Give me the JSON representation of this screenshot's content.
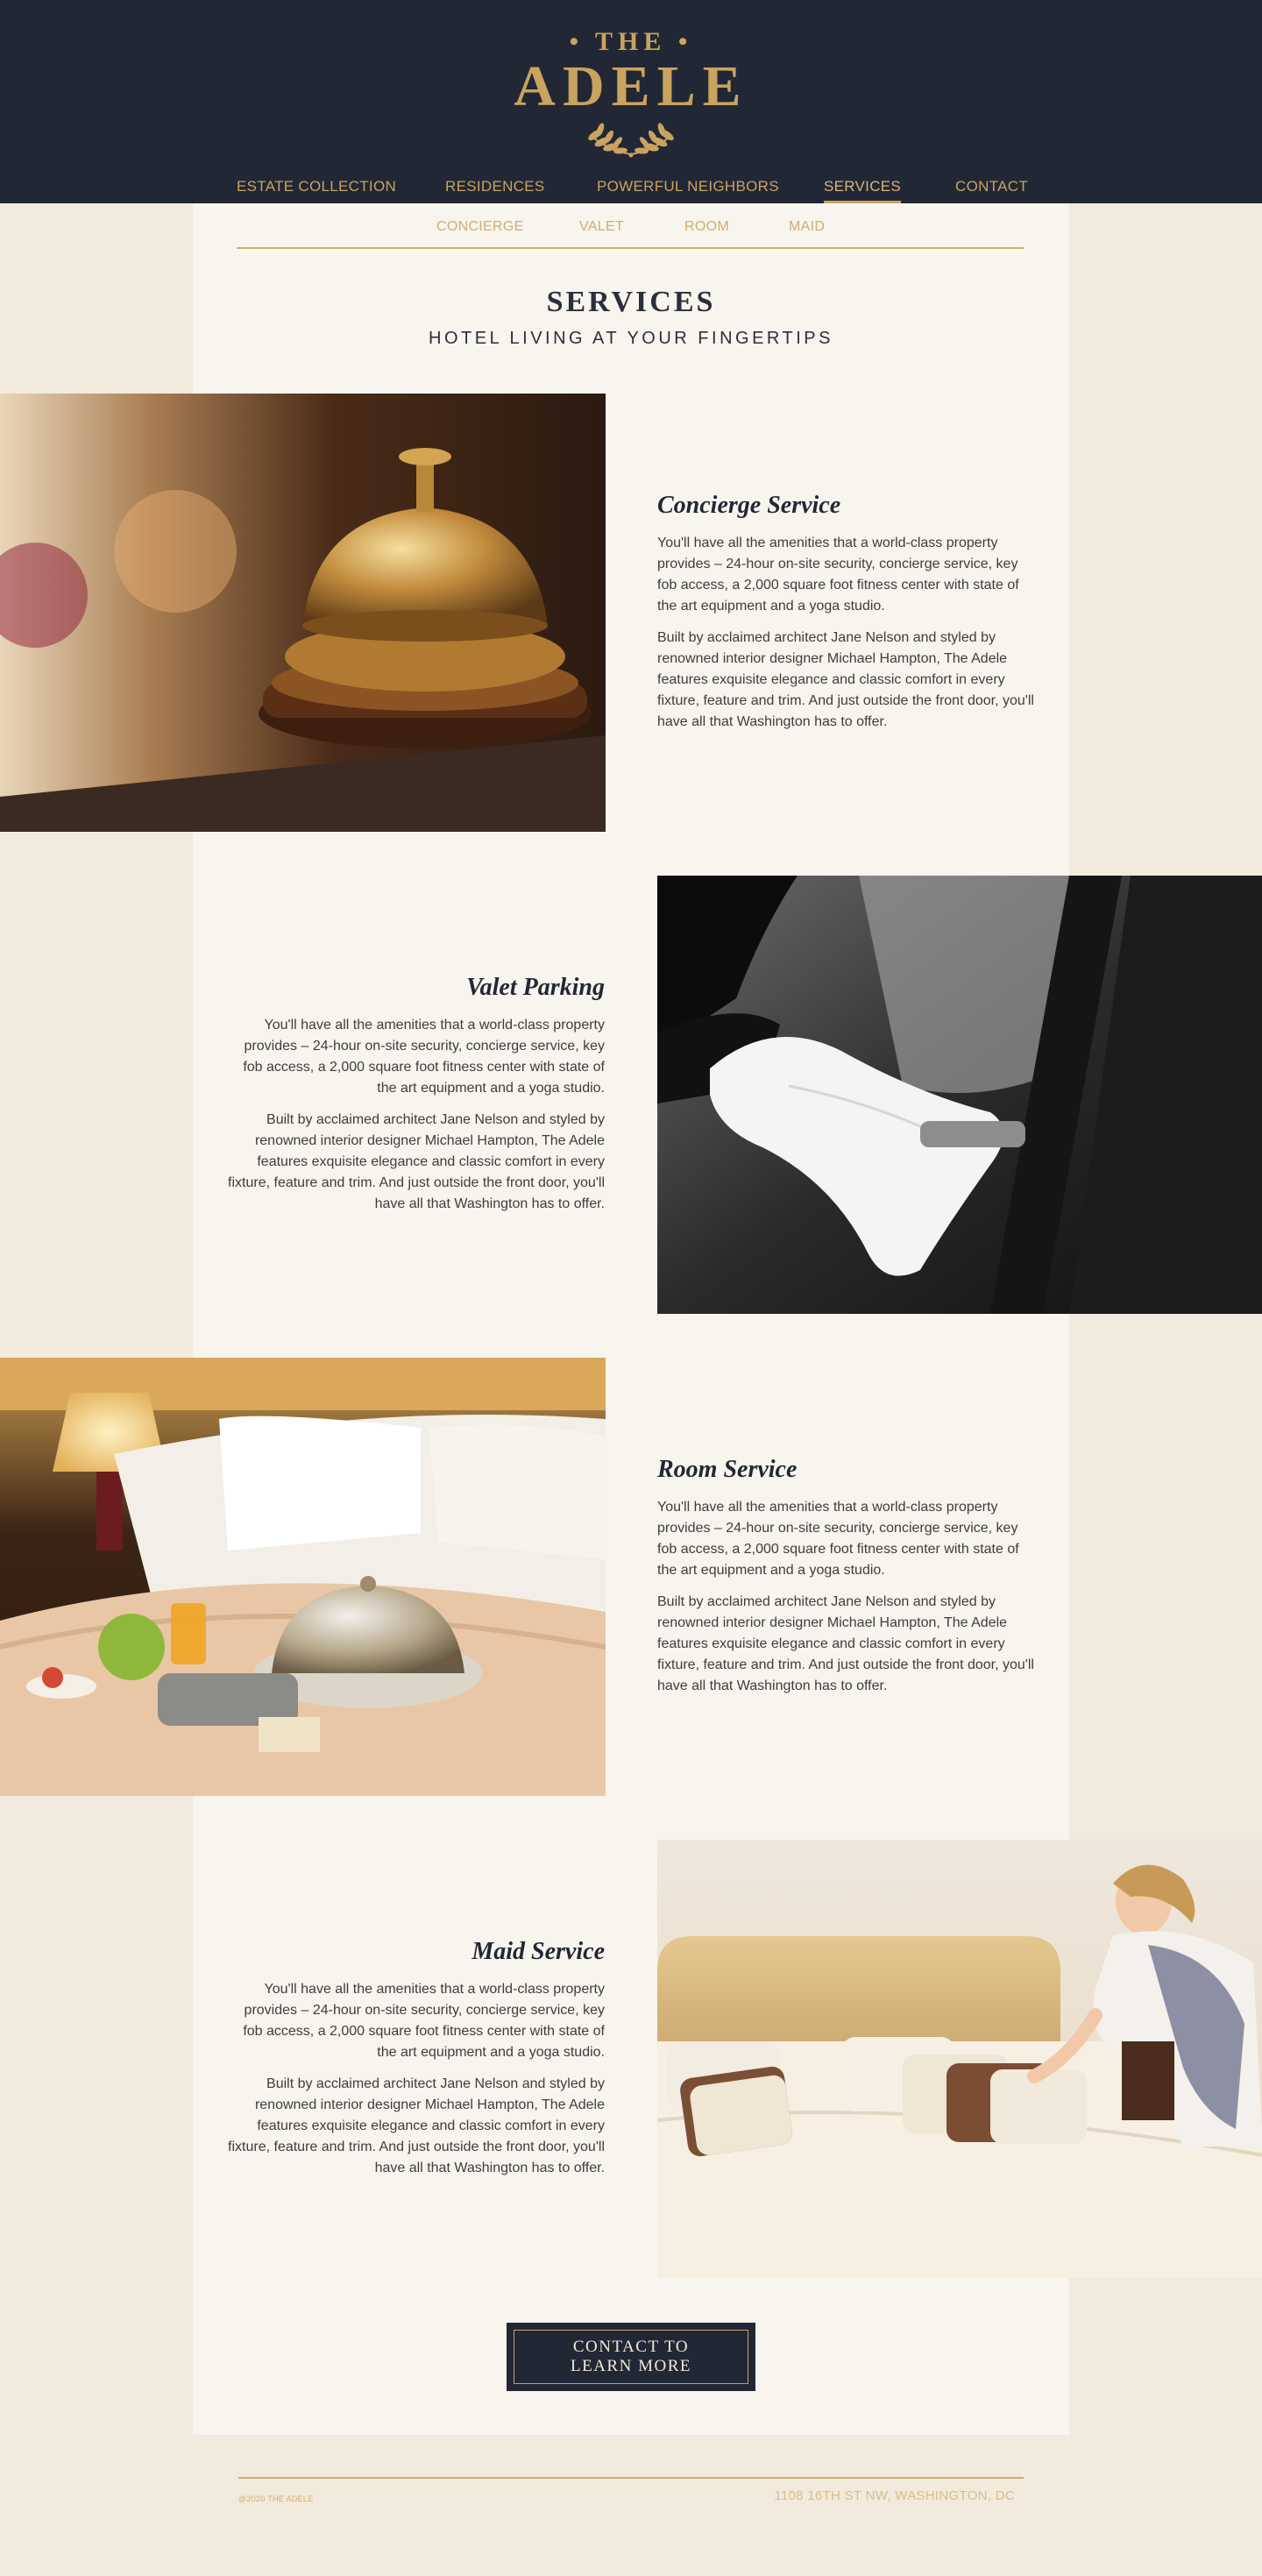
{
  "brand": {
    "the": "• THE •",
    "name": "ADELE",
    "laurel_icon": "laurel-wreath-icon"
  },
  "nav": {
    "items": [
      {
        "label": "ESTATE COLLECTION",
        "active": false
      },
      {
        "label": "RESIDENCES",
        "active": false
      },
      {
        "label": "POWERFUL NEIGHBORS",
        "active": false
      },
      {
        "label": "SERVICES",
        "active": true
      },
      {
        "label": "CONTACT",
        "active": false
      }
    ]
  },
  "subnav": {
    "items": [
      "CONCIERGE",
      "VALET",
      "ROOM",
      "MAID"
    ]
  },
  "page": {
    "title": "SERVICES",
    "subtitle": "HOTEL LIVING AT YOUR FINGERTIPS"
  },
  "services": [
    {
      "title": "Concierge Service",
      "p1": "You'll have all the amenities that a world-class property provides – 24-hour on-site security, concierge service, key fob access, a 2,000 square foot fitness center with state of the art equipment and a yoga studio.",
      "p2": "Built by acclaimed architect Jane Nelson and styled by renowned interior designer Michael Hampton, The Adele features exquisite elegance and classic comfort in every fixture, feature and trim. And just outside the front door, you'll have all that Washington has to offer.",
      "image": "concierge-bell-photo"
    },
    {
      "title": "Valet Parking",
      "p1": "You'll have all the amenities that a world-class property provides – 24-hour on-site security, concierge service, key fob access, a 2,000 square foot fitness center with state of the art equipment and a yoga studio.",
      "p2": "Built by acclaimed architect Jane Nelson and styled by renowned interior designer Michael Hampton, The Adele features exquisite elegance and classic comfort in every fixture, feature and trim. And just outside the front door, you'll have all that Washington has to offer.",
      "image": "valet-gloved-hand-photo"
    },
    {
      "title": "Room Service",
      "p1": "You'll have all the amenities that a world-class property provides – 24-hour on-site security, concierge service, key fob access, a 2,000 square foot fitness center with state of the art equipment and a yoga studio.",
      "p2": "Built by acclaimed architect Jane Nelson and styled by renowned interior designer Michael Hampton, The Adele features exquisite elegance and classic comfort in every fixture, feature and trim. And just outside the front door, you'll have all that Washington has to offer.",
      "image": "room-service-tray-photo"
    },
    {
      "title": "Maid Service",
      "p1": "You'll have all the amenities that a world-class property provides – 24-hour on-site security, concierge service, key fob access, a 2,000 square foot fitness center with state of the art equipment and a yoga studio.",
      "p2": "Built by acclaimed architect Jane Nelson and styled by renowned interior designer Michael Hampton, The Adele features exquisite elegance and classic comfort in every fixture, feature and trim. And just outside the front door, you'll have all that Washington has to offer.",
      "image": "maid-making-bed-photo"
    }
  ],
  "cta": {
    "line1": "CONTACT TO",
    "line2": "LEARN MORE"
  },
  "footer": {
    "copyright": "@2020 THE ADELE",
    "address": "1108 16TH ST NW, WASHINGTON, DC"
  },
  "colors": {
    "navy": "#212735",
    "gold": "#c9a35f",
    "cream": "#f2eadc",
    "panel": "#f8f5ef"
  }
}
